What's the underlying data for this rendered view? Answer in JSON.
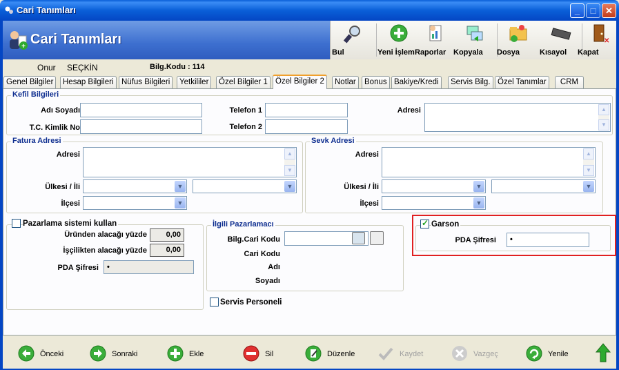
{
  "window": {
    "title": "Cari Tanımları"
  },
  "header": {
    "title": "Cari Tanımları"
  },
  "toolbar": {
    "bul": "Bul",
    "yeni_islem": "Yeni İşlem",
    "raporlar": "Raporlar",
    "kopyala": "Kopyala",
    "dosya": "Dosya",
    "kisayol": "Kısayol",
    "kapat": "Kapat"
  },
  "record": {
    "first_name": "Onur",
    "last_name": "SEÇKİN",
    "code_label": "Bilg.Kodu : 114"
  },
  "tabs": [
    {
      "label": "Genel Bilgiler"
    },
    {
      "label": "Hesap Bilgileri"
    },
    {
      "label": "Nüfus Bilgileri"
    },
    {
      "label": "Yetkililer"
    },
    {
      "label": "Özel Bilgiler 1"
    },
    {
      "label": "Özel Bilgiler 2"
    },
    {
      "label": "Notlar"
    },
    {
      "label": "Bonus"
    },
    {
      "label": "Bakiye/Kredi"
    },
    {
      "label": "Servis Bilg."
    },
    {
      "label": "Özel Tanımlar"
    },
    {
      "label": "CRM"
    }
  ],
  "kefil": {
    "legend": "Kefil Bilgileri",
    "adi_soyadi": "Adı Soyadı",
    "tc": "T.C. Kimlik No",
    "tel1": "Telefon 1",
    "tel2": "Telefon 2",
    "adresi": "Adresi"
  },
  "fatura": {
    "legend": "Fatura Adresi",
    "adresi": "Adresi",
    "ulke": "Ülkesi / İli",
    "ilce": "İlçesi"
  },
  "sevk": {
    "legend": "Sevk Adresi",
    "adresi": "Adresi",
    "ulke": "Ülkesi / İli",
    "ilce": "İlçesi"
  },
  "pazarlama": {
    "checkbox": "Pazarlama sistemi kullan",
    "urun": "Üründen alacağı yüzde",
    "urun_val": "0,00",
    "iscilik": "İşçilikten alacağı yüzde",
    "iscilik_val": "0,00",
    "pda": "PDA Şifresi",
    "pda_val": "•"
  },
  "ilgili": {
    "legend": "İlgili Pazarlamacı",
    "kod": "Bilg.Cari Kodu",
    "cari": "Cari Kodu",
    "adi": "Adı",
    "soyadi": "Soyadı"
  },
  "servis": {
    "checkbox": "Servis Personeli"
  },
  "garson": {
    "checkbox": "Garson",
    "pda": "PDA Şifresi",
    "pda_val": "•"
  },
  "nav": {
    "onceki": "Önceki",
    "sonraki": "Sonraki",
    "ekle": "Ekle",
    "sil": "Sil",
    "duzenle": "Düzenle",
    "kaydet": "Kaydet",
    "vazgec": "Vazgeç",
    "yenile": "Yenile"
  },
  "colors": {
    "title_bar": "#0a5fd8",
    "header": "#3d6fcf",
    "legend": "#0d2d8f",
    "highlight": "#e02020"
  }
}
